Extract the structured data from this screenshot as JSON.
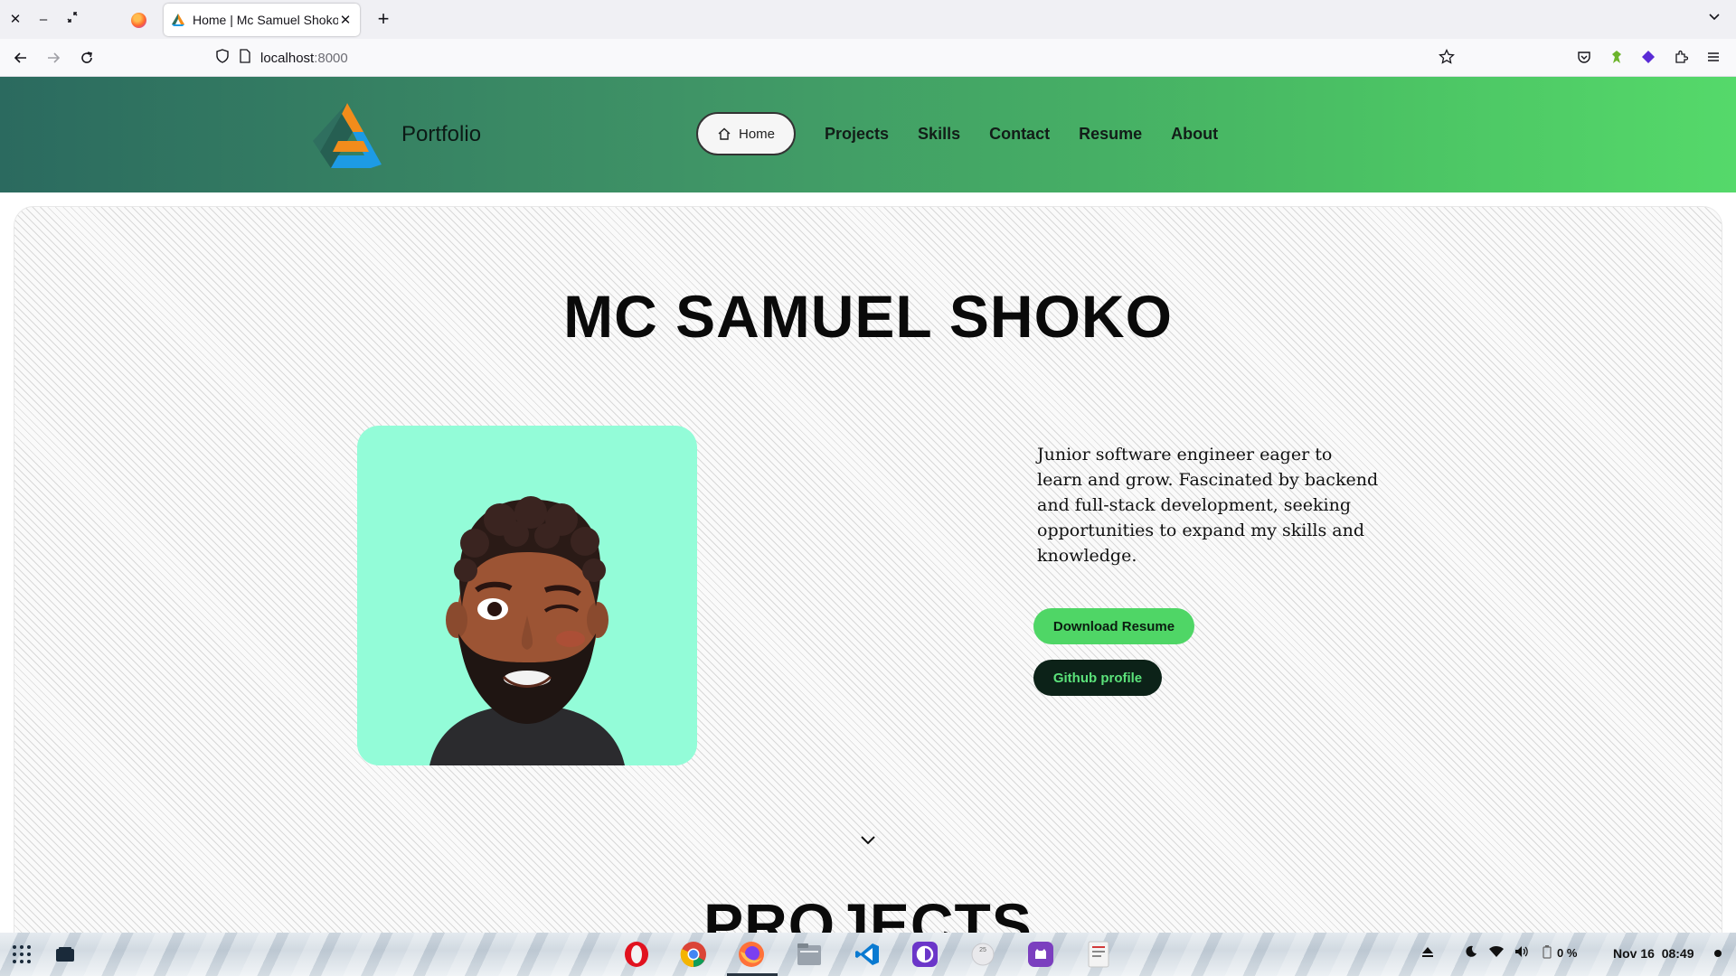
{
  "browser": {
    "active_tab_title": "Home | Mc Samuel Shoko",
    "url_host": "localhost",
    "url_port": ":8000",
    "window_controls": [
      "close-icon",
      "minimize-icon",
      "restore-icon"
    ]
  },
  "site": {
    "brand_name": "Portfolio",
    "menu": {
      "home": "Home",
      "projects": "Projects",
      "skills": "Skills",
      "contact": "Contact",
      "resume": "Resume",
      "about": "About"
    },
    "hero_title": "MC SAMUEL SHOKO",
    "bio": "Junior software engineer eager to learn and grow. Fascinated by backend and full-stack development, seeking opportunities to expand my skills and knowledge.",
    "download_resume_label": "Download Resume",
    "github_label": "Github profile",
    "projects_heading": "PROJECTS",
    "colors": {
      "header_gradient_start": "#2b6a5f",
      "header_gradient_end": "#55d96a",
      "avatar_bg": "#93fcd8",
      "primary_button": "#4fd666",
      "dark_button": "#0c2218"
    }
  },
  "taskbar": {
    "apps": [
      "opera-icon",
      "chrome-icon",
      "firefox-icon",
      "files-icon",
      "vscode-icon",
      "tor-icon",
      "calendar-icon",
      "github-desktop-icon",
      "text-editor-icon"
    ],
    "calendar_day": "25",
    "battery": "0 %",
    "datetime": "Nov 16  08:49"
  }
}
